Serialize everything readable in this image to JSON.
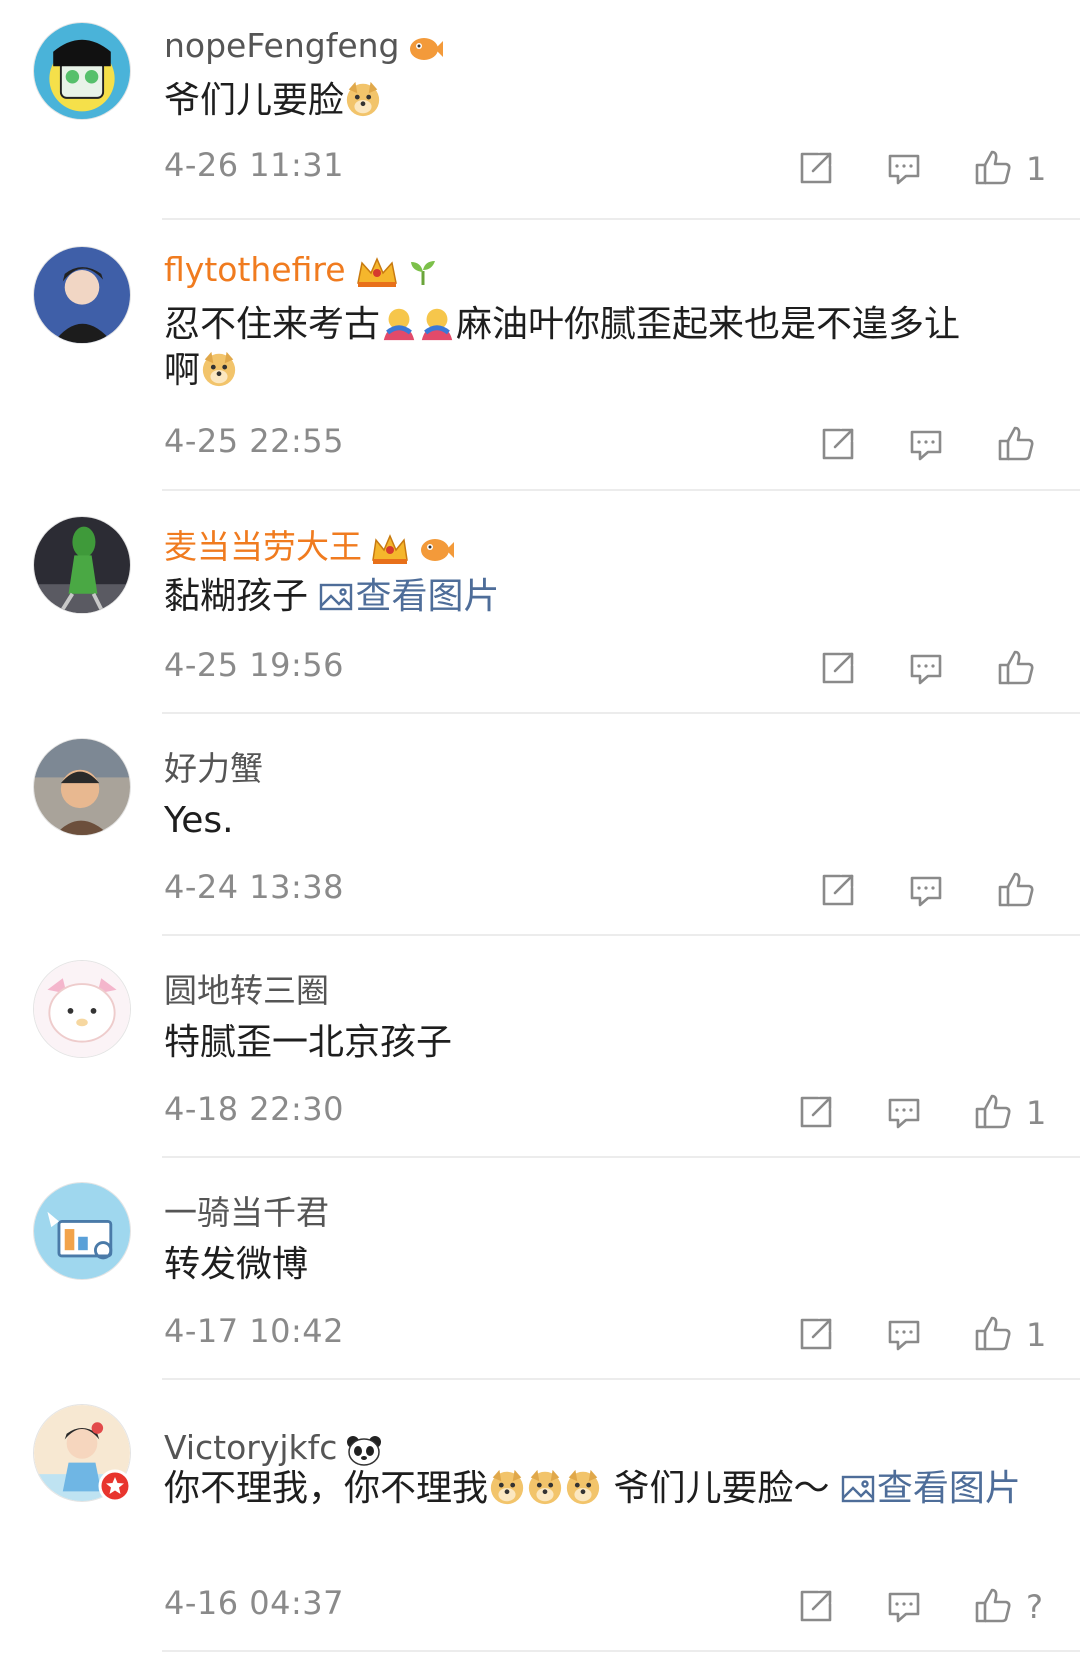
{
  "comments": [
    {
      "name": "nopeFengfeng",
      "text": "爷们儿要脸",
      "time": "4-26 11:31",
      "likes": "1"
    },
    {
      "name": "flytothefire",
      "text1": "忍不住来考古",
      "text2": "麻油叶你腻歪起来也是不遑多让",
      "text3": "啊",
      "time": "4-25 22:55"
    },
    {
      "name": "麦当当劳大王",
      "text": "黏糊孩子",
      "link": "查看图片",
      "time": "4-25 19:56"
    },
    {
      "name": "好力蟹",
      "text": "Yes.",
      "time": "4-24 13:38"
    },
    {
      "name": "圆地转三圈",
      "text": "特腻歪一北京孩子",
      "time": "4-18 22:30",
      "likes": "1"
    },
    {
      "name": "一骑当千君",
      "text": "转发微博",
      "time": "4-17 10:42",
      "likes": "1"
    },
    {
      "name": "Victoryjkfc",
      "text1": "你不理我，你不理我",
      "text2": " 爷们儿要脸～ ",
      "link": "查看图片",
      "time": "4-16 04:37",
      "likes": "?"
    }
  ],
  "colors": {
    "accent_name": "#f07b1f",
    "link": "#4e6d99",
    "meta": "#8a8a8a"
  },
  "icons": [
    "share-icon",
    "comment-icon",
    "like-icon",
    "image-icon",
    "doge-emoji",
    "hug-emoji"
  ]
}
